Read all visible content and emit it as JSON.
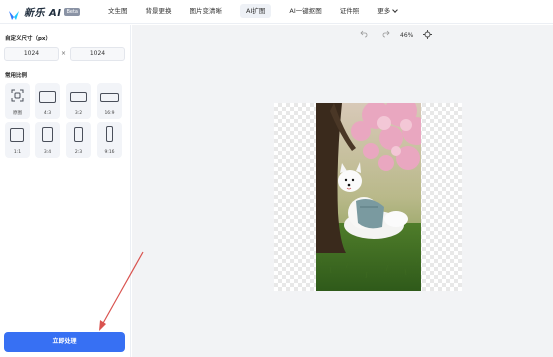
{
  "brand": {
    "name": "新乐 AI",
    "badge": "Beta"
  },
  "nav": [
    {
      "label": "文生图"
    },
    {
      "label": "背景更换"
    },
    {
      "label": "图片变清晰"
    },
    {
      "label": "AI扩图"
    },
    {
      "label": "AI一键抠图"
    },
    {
      "label": "证件照"
    },
    {
      "label": "更多"
    }
  ],
  "sidebar": {
    "custom_size_title": "自定义尺寸（px）",
    "width_value": "1024",
    "height_value": "1024",
    "times": "×",
    "ratio_title": "常用比例",
    "ratios": [
      {
        "label": "原图"
      },
      {
        "label": "4:3"
      },
      {
        "label": "3:2"
      },
      {
        "label": "16:9"
      },
      {
        "label": "1:1"
      },
      {
        "label": "3:4"
      },
      {
        "label": "2:3"
      },
      {
        "label": "9:16"
      }
    ],
    "submit_label": "立即处理"
  },
  "toolbar": {
    "zoom": "46%",
    "undo_icon": "undo-icon",
    "redo_icon": "redo-icon",
    "fit_icon": "locate-icon"
  },
  "colors": {
    "accent": "#3770f3",
    "canvas_bg": "#f2f3f5",
    "arrow": "#d9534f"
  }
}
